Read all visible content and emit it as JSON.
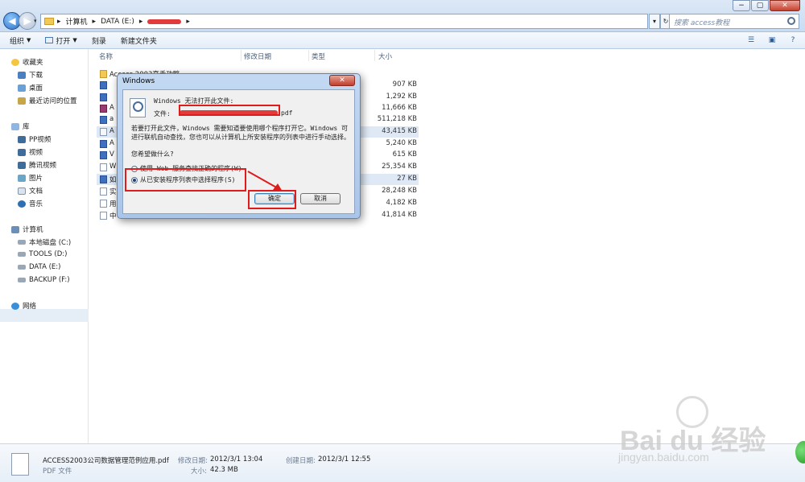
{
  "window": {
    "controls": [
      "−",
      "▢",
      "✕"
    ],
    "nav_back": "◀",
    "nav_forward": "▶"
  },
  "address": {
    "parts": [
      "计算机",
      "DATA (E:)"
    ],
    "separator": "▸",
    "search_placeholder": "搜索 access教程"
  },
  "toolbar": {
    "organize": "组织",
    "open": "打开",
    "burn": "刻录",
    "new_folder": "新建文件夹"
  },
  "columns": {
    "name": "名称",
    "modified": "修改日期",
    "type": "类型",
    "size": "大小"
  },
  "navpane": {
    "favorites": "收藏夹",
    "downloads": "下载",
    "desktop": "桌面",
    "recent": "最近访问的位置",
    "libraries": "库",
    "pp_video": "PP视频",
    "videos": "视频",
    "tencent_video": "腾讯视频",
    "pictures": "图片",
    "documents": "文档",
    "music": "音乐",
    "computer": "计算机",
    "drive_c": "本地磁盘 (C:)",
    "drive_d": "TOOLS (D:)",
    "drive_e": "DATA (E:)",
    "drive_f": "BACKUP (F:)",
    "network": "网络"
  },
  "files": [
    {
      "name": "Access 2003高手功略",
      "size": ""
    },
    {
      "name": "",
      "size": "907 KB"
    },
    {
      "name": "",
      "size": "1,292 KB"
    },
    {
      "name": "A",
      "size": "11,666 KB"
    },
    {
      "name": "a",
      "size": "511,218 KB"
    },
    {
      "name": "A",
      "size": "43,415 KB"
    },
    {
      "name": "A",
      "size": "5,240 KB"
    },
    {
      "name": "V",
      "size": "615 KB"
    },
    {
      "name": "W",
      "size": "25,354 KB"
    },
    {
      "name": "如",
      "size": "27 KB"
    },
    {
      "name": "实",
      "size": "28,248 KB"
    },
    {
      "name": "用",
      "size": "4,182 KB"
    },
    {
      "name": "中",
      "size": "41,814 KB"
    }
  ],
  "dialog": {
    "title": "Windows",
    "close": "✕",
    "heading": "Windows 无法打开此文件:",
    "file_label": "文件:",
    "file_ext": "pdf",
    "explanation": "若要打开此文件，Windows 需要知道要使用哪个程序打开它。Windows 可进行联机自动查找，您也可以从计算机上所安装程序的列表中进行手动选择。",
    "question": "您希望做什么?",
    "option_web": "使用 Web 服务查找正确的程序(W)",
    "option_list": "从已安装程序列表中选择程序(S)",
    "ok": "确定",
    "cancel": "取消"
  },
  "details": {
    "filename": "ACCESS2003公司数据管理范例应用.pdf",
    "filetype": "PDF 文件",
    "modified_label": "修改日期:",
    "modified": "2012/3/1 13:04",
    "size_label": "大小:",
    "size": "42.3 MB",
    "created_label": "创建日期:",
    "created": "2012/3/1 12:55"
  },
  "watermark": {
    "brand": "Bai du 经验",
    "url": "jingyan.baidu.com"
  }
}
